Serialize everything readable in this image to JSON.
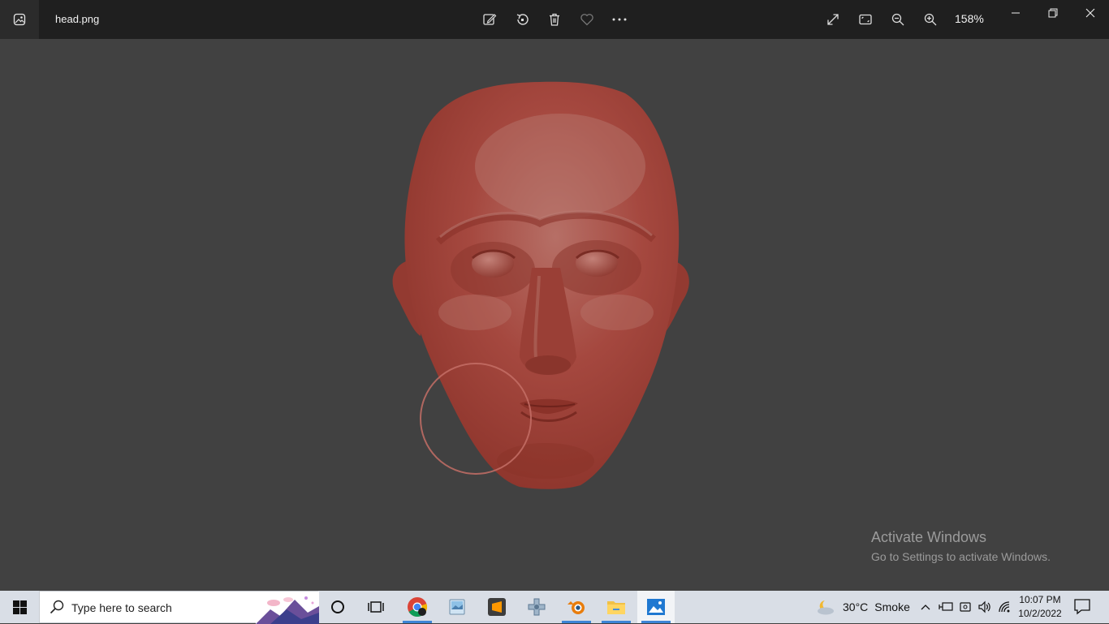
{
  "window": {
    "file_name": "head.png",
    "zoom": "158%"
  },
  "toolbar": {
    "icons": [
      "edit-image-icon",
      "rotate-icon",
      "delete-icon",
      "favorite-icon",
      "more-icon"
    ],
    "right_icons": [
      "fullscreen-icon",
      "fit-window-icon",
      "zoom-out-icon",
      "zoom-in-icon"
    ]
  },
  "watermark": {
    "title": "Activate Windows",
    "subtitle": "Go to Settings to activate Windows."
  },
  "taskbar": {
    "search_placeholder": "Type here to search",
    "apps": [
      "cortana",
      "task-view",
      "chrome",
      "photo-viewer",
      "sublime-text",
      "game-app",
      "blender",
      "file-explorer",
      "photos"
    ],
    "weather_temp": "30°C",
    "weather_condition": "Smoke",
    "time": "10:07 PM",
    "date": "10/2/2022"
  },
  "colors": {
    "accent": "#3c84d6",
    "head": "#a8473f",
    "canvas": "#414141"
  }
}
